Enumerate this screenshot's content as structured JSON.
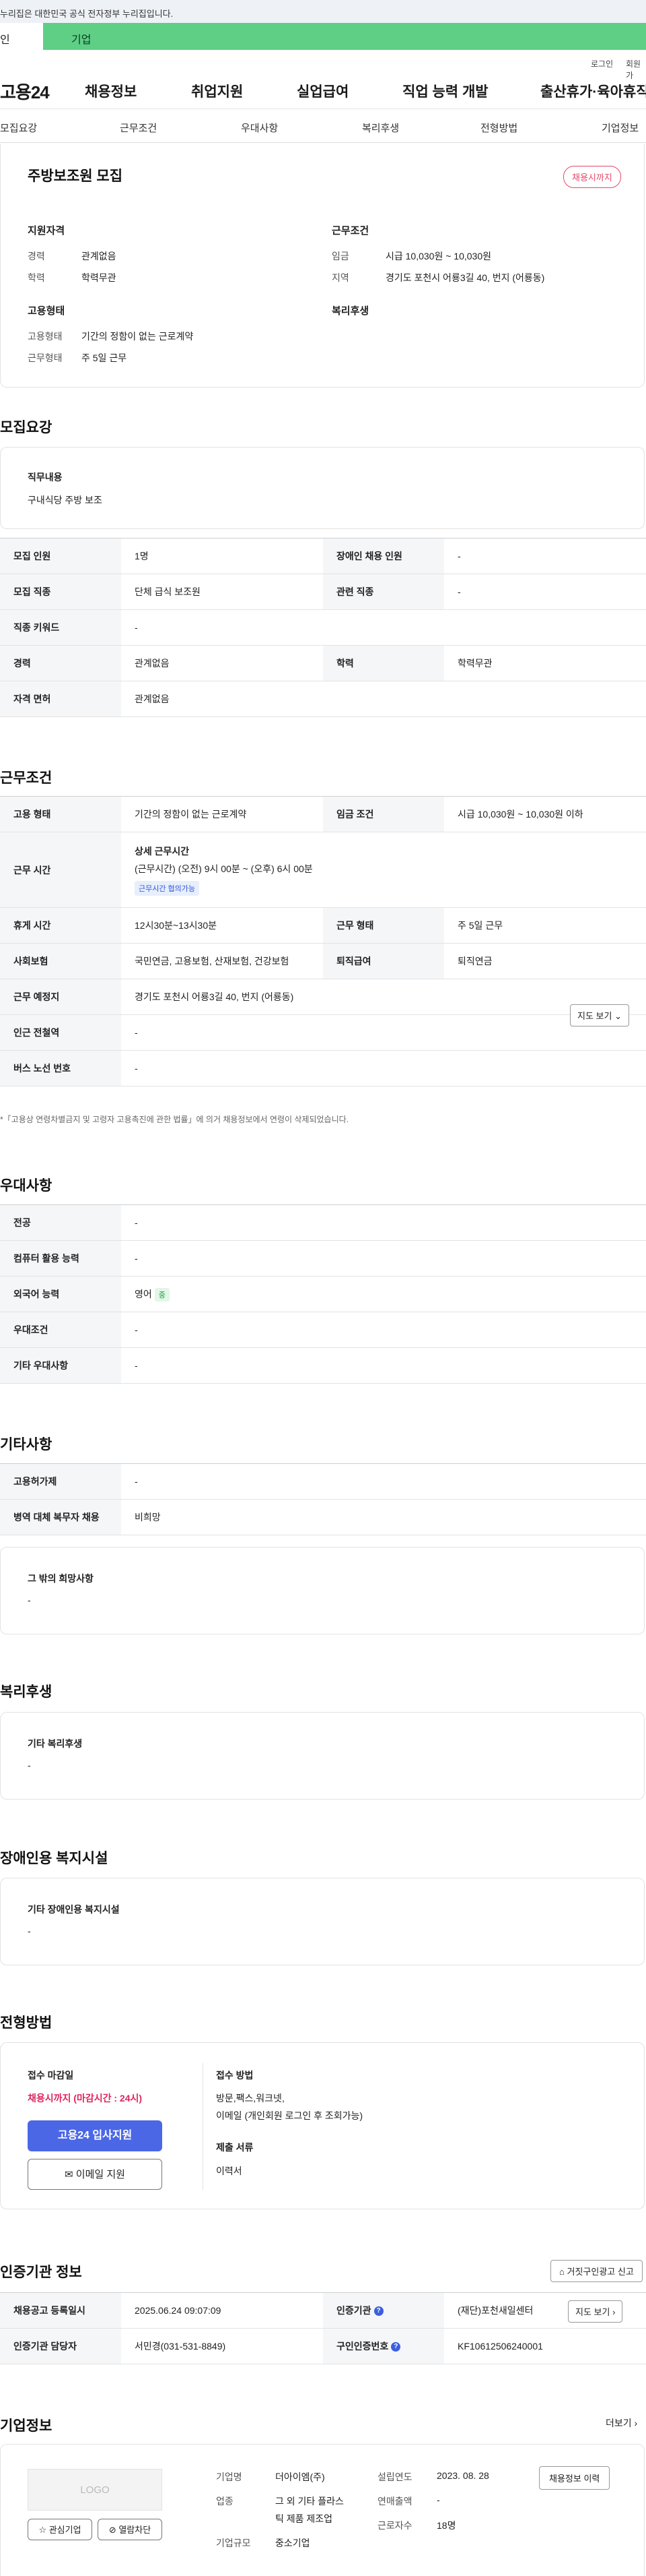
{
  "gov_banner": "누리집은 대한민국 공식 전자정부 누리집입니다.",
  "tabs": {
    "person": "인",
    "company": "기업"
  },
  "util": {
    "login": "로그인",
    "join": "회원가"
  },
  "gnb": {
    "logo": "고용24",
    "items": [
      "채용정보",
      "취업지원",
      "실업급여",
      "직업 능력 개발",
      "출산휴가·육아휴직"
    ]
  },
  "subnav": [
    "모집요강",
    "근무조건",
    "우대사항",
    "복리후생",
    "전형방법",
    "기업정보"
  ],
  "job": {
    "title": "주방보조원 모집",
    "badge": "채용시까지",
    "qual_title": "지원자격",
    "qual_career_lbl": "경력",
    "qual_career": "관계없음",
    "qual_edu_lbl": "학력",
    "qual_edu": "학력무관",
    "emp_title": "고용형태",
    "emp_type_lbl": "고용형태",
    "emp_type": "기간의 정함이 없는 근로계약",
    "emp_days_lbl": "근무형태",
    "emp_days": "주 5일 근무",
    "cond_title": "근무조건",
    "cond_wage_lbl": "임금",
    "cond_wage": "시급 10,030원 ~ 10,030원",
    "cond_area_lbl": "지역",
    "cond_area": "경기도 포천시 어룡3길 40, 번지 (어룡동)",
    "welfare_title": "복리후생"
  },
  "recruit": {
    "section": "모집요강",
    "duty_lbl": "직무내용",
    "duty": "구내식당 주방 보조",
    "rows": {
      "count_lbl": "모집 인원",
      "count": "1명",
      "disabled_lbl": "장애인 채용 인원",
      "disabled": "-",
      "job_lbl": "모집 직종",
      "job": "단체 급식 보조원",
      "related_lbl": "관련 직종",
      "related": "-",
      "kw_lbl": "직종 키워드",
      "kw": "-",
      "career_lbl": "경력",
      "career": "관계없음",
      "edu_lbl": "학력",
      "edu": "학력무관",
      "license_lbl": "자격 면허",
      "license": "관계없음"
    }
  },
  "work": {
    "section": "근무조건",
    "type_lbl": "고용 형태",
    "type": "기간의 정함이 없는 근로계약",
    "wage_lbl": "임금 조건",
    "wage": "시급 10,030원 ~ 10,030원 이하",
    "time_lbl": "근무 시간",
    "time_head": "상세 근무시간",
    "time_detail": "(근무시간) (오전) 9시 00분 ~ (오후) 6시 00분",
    "time_chip": "근무시간 협의가능",
    "break_lbl": "휴게 시간",
    "break": "12시30분~13시30분",
    "shift_lbl": "근무 형태",
    "shift": "주 5일 근무",
    "ins_lbl": "사회보험",
    "ins": "국민연금, 고용보험, 산재보험, 건강보험",
    "ret_lbl": "퇴직급여",
    "ret": "퇴직연금",
    "place_lbl": "근무 예정지",
    "place": "경기도 포천시 어룡3길 40, 번지 (어룡동)",
    "map_btn": "지도 보기",
    "station_lbl": "인근 전철역",
    "station": "-",
    "bus_lbl": "버스 노선 번호",
    "bus": "-",
    "note": "「고용상 연령차별금지 및 고령자 고용촉진에 관한 법률」에 의거 채용정보에서 연령이 삭제되었습니다."
  },
  "pref": {
    "section": "우대사항",
    "major_lbl": "전공",
    "major": "-",
    "pc_lbl": "컴퓨터 활용 능력",
    "pc": "-",
    "lang_lbl": "외국어 능력",
    "lang": "영어",
    "lang_chip": "중",
    "cond_lbl": "우대조건",
    "cond": "-",
    "etc_lbl": "기타 우대사항",
    "etc": "-"
  },
  "other": {
    "section": "기타사항",
    "hire_lbl": "고용허가제",
    "hire": "-",
    "mil_lbl": "병역 대체 복무자 채용",
    "mil": "비희망",
    "wish_title": "그 밖의 희망사항",
    "wish": "-"
  },
  "benefit": {
    "section": "복리후생",
    "title": "기타 복리후생",
    "value": "-"
  },
  "facility": {
    "section": "장애인용 복지시설",
    "title": "기타 장애인용 복지시설",
    "value": "-"
  },
  "process": {
    "section": "전형방법",
    "deadline_lbl": "접수 마감일",
    "deadline": "채용시까지 (마감시간 : 24시)",
    "apply_btn": "고용24 입사지원",
    "email_btn": "이메일 지원",
    "method_lbl": "접수 방법",
    "method": "방문,팩스,워크넷,",
    "method2": "이메일 (개인회원 로그인 후 조회가능)",
    "docs_lbl": "제출 서류",
    "docs": "이력서"
  },
  "agency": {
    "section": "인증기관 정보",
    "report_btn": "거짓구인광고 신고",
    "reg_lbl": "채용공고 등록일시",
    "reg": "2025.06.24 09:07:09",
    "org_lbl": "인증기관",
    "org": "(재단)포천새일센터",
    "map_btn": "지도 보기",
    "mgr_lbl": "인증기관 담당자",
    "mgr": "서민경(031-531-8849)",
    "num_lbl": "구인인증번호",
    "num": "KF10612506240001"
  },
  "company": {
    "section": "기업정보",
    "more": "더보기",
    "logo": "LOGO",
    "fav_btn": "관심기업",
    "block_btn": "열람차단",
    "name_lbl": "기업명",
    "name": "더아이엠(주)",
    "found_lbl": "설립연도",
    "found": "2023. 08. 28",
    "history_btn": "채용정보 이력",
    "ind_lbl": "업종",
    "ind": "그 외 기타 플라스",
    "ind2": "틱 제품 제조업",
    "sales_lbl": "연매출액",
    "sales": "-",
    "emp_lbl": "근로자수",
    "emp": "18명",
    "size_lbl": "기업규모",
    "size": "중소기업"
  }
}
